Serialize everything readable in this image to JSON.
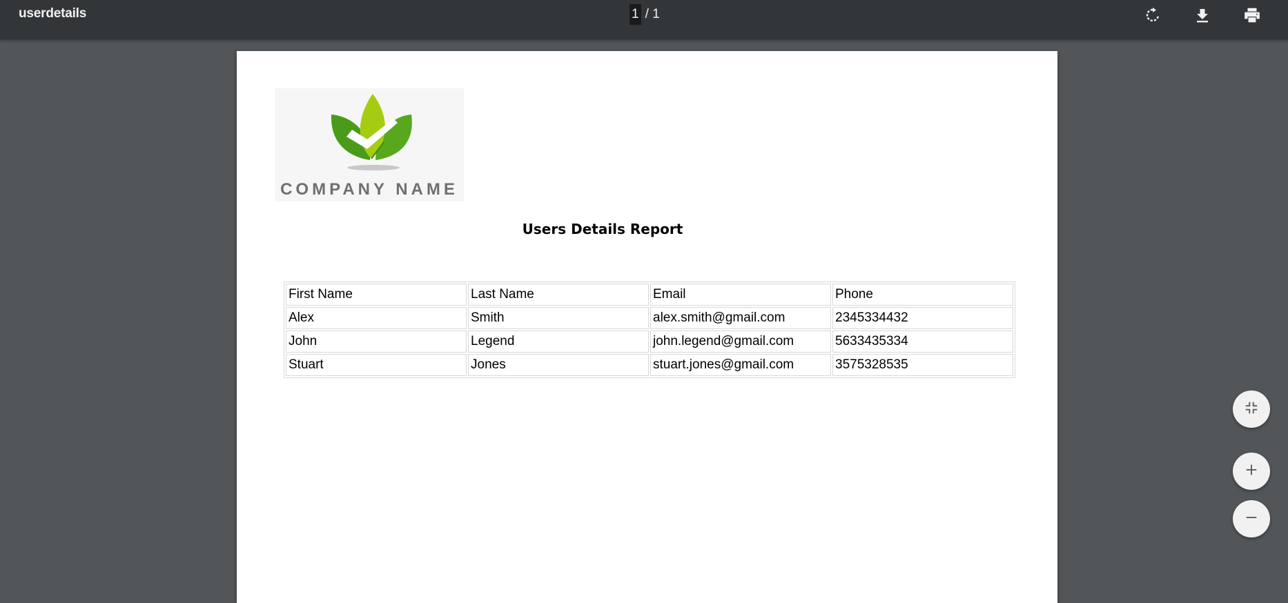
{
  "toolbar": {
    "title": "userdetails",
    "page_current": "1",
    "page_rest": "/ 1",
    "buttons": {
      "rotate": "rotate-icon",
      "download": "download-icon",
      "print": "print-icon"
    }
  },
  "document": {
    "logo_text": "COMPANY NAME",
    "report_title": "Users Details Report",
    "table": {
      "headers": [
        "First Name",
        "Last Name",
        "Email",
        "Phone"
      ],
      "rows": [
        [
          "Alex",
          "Smith",
          "alex.smith@gmail.com",
          "2345334432"
        ],
        [
          "John",
          "Legend",
          "john.legend@gmail.com",
          "5633435334"
        ],
        [
          "Stuart",
          "Jones",
          "stuart.jones@gmail.com",
          "3575328535"
        ]
      ]
    }
  },
  "zoom_controls": {
    "fit": "fit-to-page-icon",
    "zoom_in": "plus-icon",
    "zoom_out": "minus-icon"
  },
  "colors": {
    "toolbar_bg": "#323639",
    "viewer_bg": "#525659",
    "logo_green_dark": "#4a9a1c",
    "logo_green_light": "#a6cc12"
  }
}
